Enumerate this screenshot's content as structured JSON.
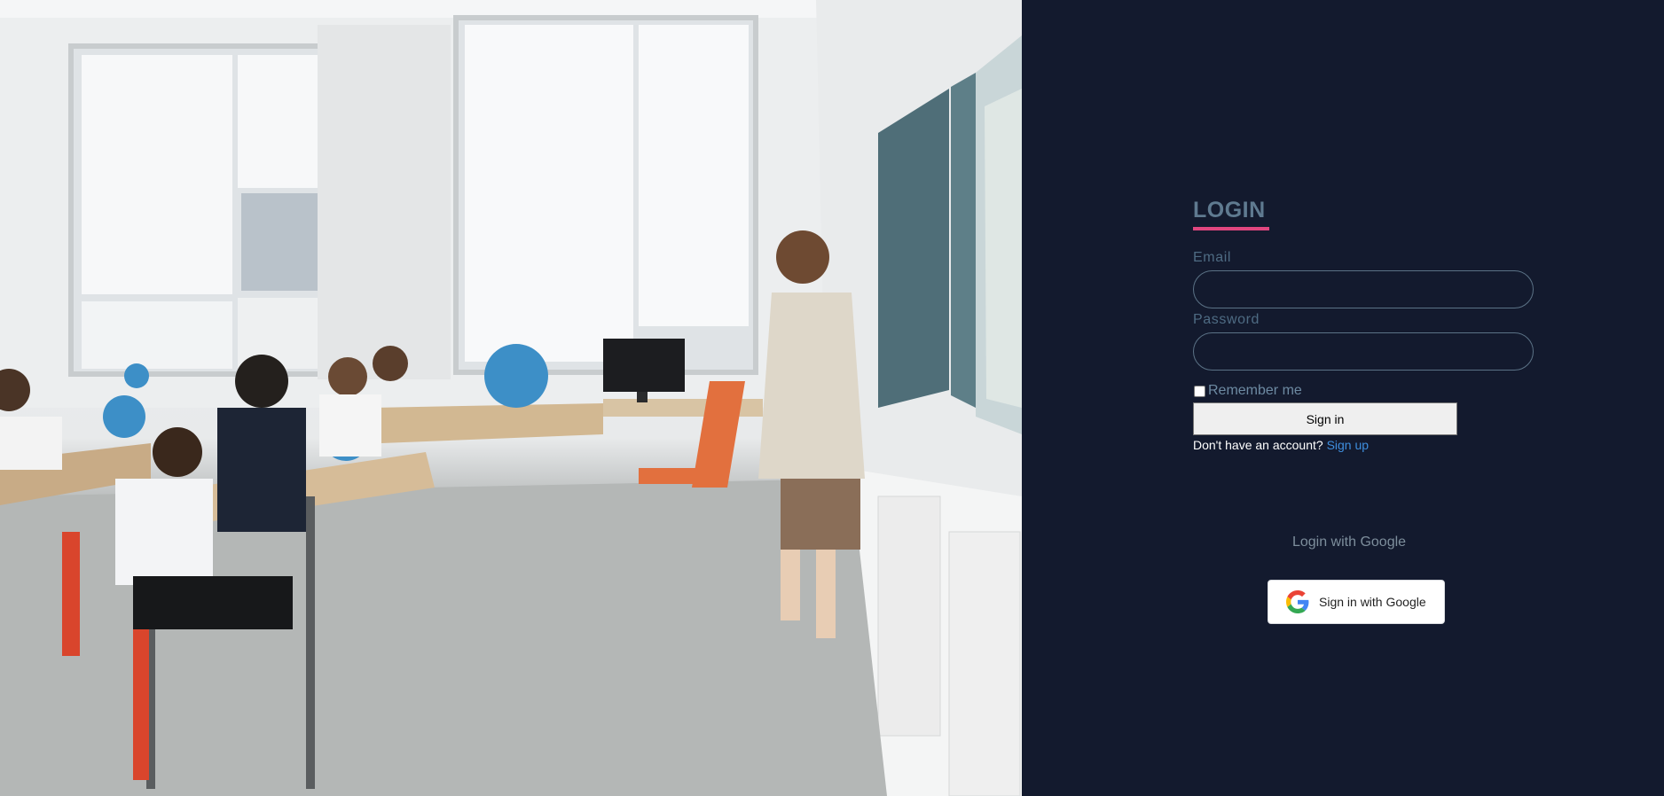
{
  "login": {
    "title": "LOGIN",
    "email_label": "Email",
    "email_value": "",
    "password_label": "Password",
    "password_value": "",
    "remember_label": "Remember me",
    "remember_checked": false,
    "signin_label": "Sign in",
    "no_account_text": "Don't have an account?",
    "signup_link": "Sign up"
  },
  "google": {
    "caption": "Login with Google",
    "button_label": "Sign in with Google",
    "icon": "google-g-icon"
  },
  "colors": {
    "panel_background": "#131a2e",
    "title": "#5f7a90",
    "title_underline": "#e0467f",
    "link": "#3e8ede"
  }
}
